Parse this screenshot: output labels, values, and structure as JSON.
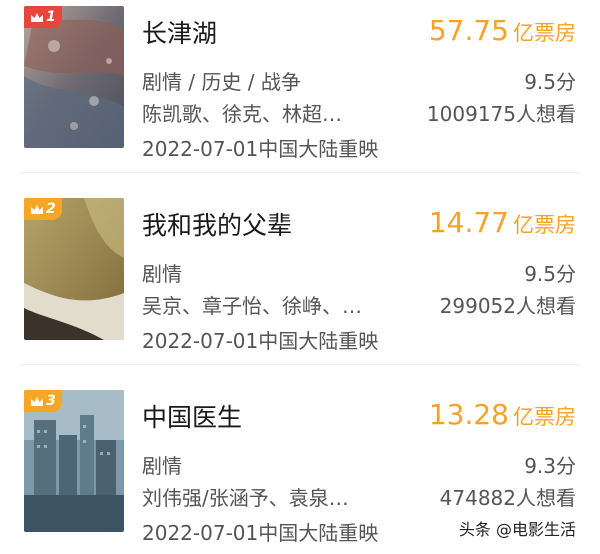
{
  "movies": [
    {
      "rank": "1",
      "rank_color": "#e8453c",
      "title": "长津湖",
      "box_office_value": "57.75",
      "box_office_unit": "亿票房",
      "genre": "剧情 / 历史 / 战争",
      "score": "9.5分",
      "cast": "陈凯歌、徐克、林超…",
      "wish_count": "1009175人想看",
      "release": "2022-07-01中国大陆重映"
    },
    {
      "rank": "2",
      "rank_color": "#f5a623",
      "title": "我和我的父辈",
      "box_office_value": "14.77",
      "box_office_unit": "亿票房",
      "genre": "剧情",
      "score": "9.5分",
      "cast": "吴京、章子怡、徐峥、…",
      "wish_count": "299052人想看",
      "release": "2022-07-01中国大陆重映"
    },
    {
      "rank": "3",
      "rank_color": "#f5a623",
      "title": "中国医生",
      "box_office_value": "13.28",
      "box_office_unit": "亿票房",
      "genre": "剧情",
      "score": "9.3分",
      "cast": "刘伟强/张涵予、袁泉…",
      "wish_count": "474882人想看",
      "release": "2022-07-01中国大陆重映"
    }
  ],
  "watermark": "头条 @电影生活"
}
